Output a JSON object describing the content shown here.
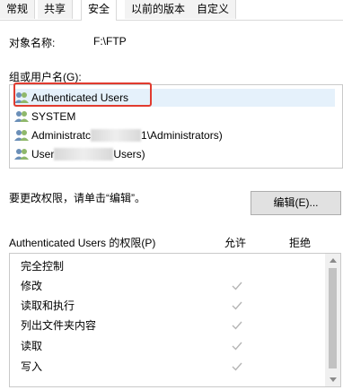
{
  "tabs": [
    {
      "label": "常规"
    },
    {
      "label": "共享"
    },
    {
      "label": "安全"
    },
    {
      "label": "以前的版本"
    },
    {
      "label": "自定义"
    }
  ],
  "object": {
    "label": "对象名称:",
    "value": "F:\\FTP"
  },
  "groups": {
    "label": "组或用户名(G):",
    "users": [
      {
        "label": "Authenticated Users"
      },
      {
        "label": "SYSTEM"
      },
      {
        "prefix": "Administratc",
        "suffix": "1\\Administrators)"
      },
      {
        "prefix": "User",
        "suffix": "Users)"
      }
    ]
  },
  "change": {
    "text": "要更改权限，请单击“编辑”。",
    "button_label": "编辑(E)..."
  },
  "permissions": {
    "title": "Authenticated Users 的权限(P)",
    "allow_header": "允许",
    "deny_header": "拒绝",
    "rows": [
      {
        "label": "完全控制",
        "allow": false
      },
      {
        "label": "修改",
        "allow": true
      },
      {
        "label": "读取和执行",
        "allow": true
      },
      {
        "label": "列出文件夹内容",
        "allow": true
      },
      {
        "label": "读取",
        "allow": true
      },
      {
        "label": "写入",
        "allow": true
      }
    ]
  },
  "colors": {
    "highlight": "#e13b2f",
    "check": "#b5b5b5",
    "selected_row": "#e5f1fb"
  }
}
